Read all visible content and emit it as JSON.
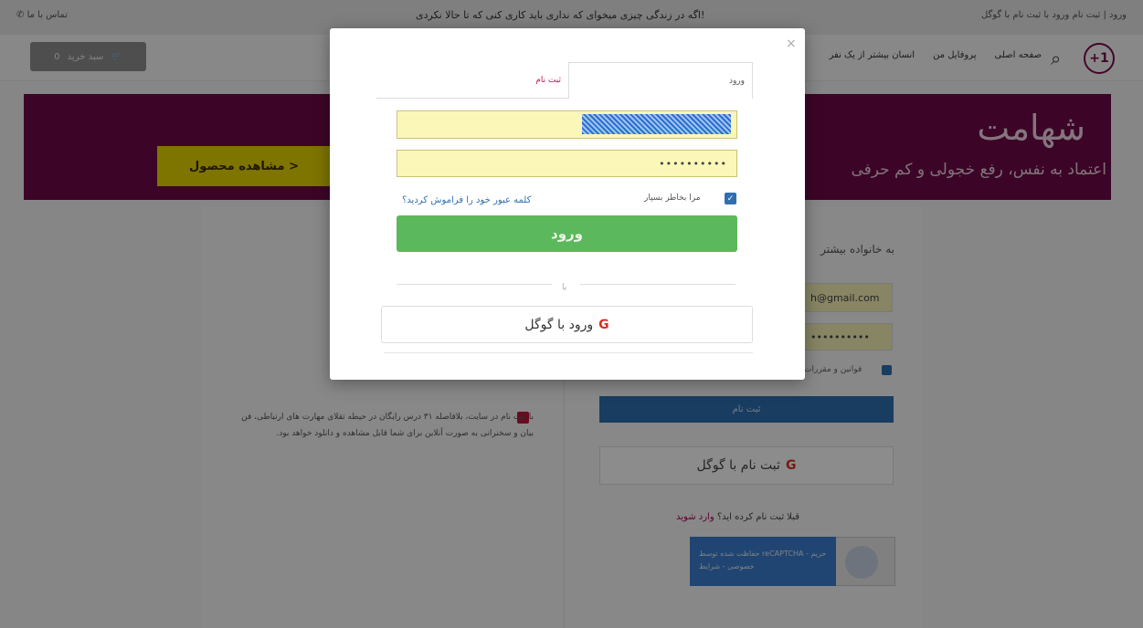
{
  "topbar": {
    "contact": "تماس با ما",
    "promo": "اگه در زندگی چیزی میخوای که نداری باید کاری کنی که تا حالا نکردی!",
    "auth": "ورود | ثبت نام ورود با ثبت نام با گوگل"
  },
  "nav": {
    "logo": "+1",
    "links": [
      "صفحه اصلی",
      "پروفایل من",
      "انسان بیشتر از یک نفر"
    ],
    "cart": "سبد خرید",
    "cart_count": "0"
  },
  "hero": {
    "title": "شهامت",
    "subtitle": "اعتماد به نفس، رفع خجولی و کم حرفی",
    "cta": "مشاهده محصول >"
  },
  "background": {
    "welcome": "به خانواده بیشتر",
    "email_value": "h@gmail.com",
    "password_value": "••••••••••",
    "terms": "قوانین و مقررات",
    "signup_button": "ثبت نام",
    "signup_google": "ثبت نام با گوگل",
    "already": "قبلا ثبت نام کرده اید؟",
    "login_link": "وارد شوید",
    "captcha": "حفاظت شده توسط reCAPTCHA - حریم خصوصی - شرایط",
    "gift": "با ثبت نام در سایت، بلافاصله ۳۱ درس رایگان در حیطه تقلای مهارت های ارتباطی، فن بیان و سخنرانی به صورت آنلاین برای شما قابل مشاهده و دانلود خواهد بود."
  },
  "modal": {
    "close": "×",
    "tab_login": "ورود",
    "tab_signup": "ثبت نام",
    "password_value": "••••••••••",
    "remember": "مرا بخاطر بسپار",
    "forgot": "کلمه عبور خود را فراموش کردید؟",
    "login_button": "ورود",
    "or": "یا",
    "google_button": "ورود با گوگل",
    "google_g": "G"
  },
  "colors": {
    "brand": "#6d0a47",
    "accent_yellow": "#e6d400",
    "login_green": "#5cb85c",
    "blue": "#2f6fb0"
  }
}
